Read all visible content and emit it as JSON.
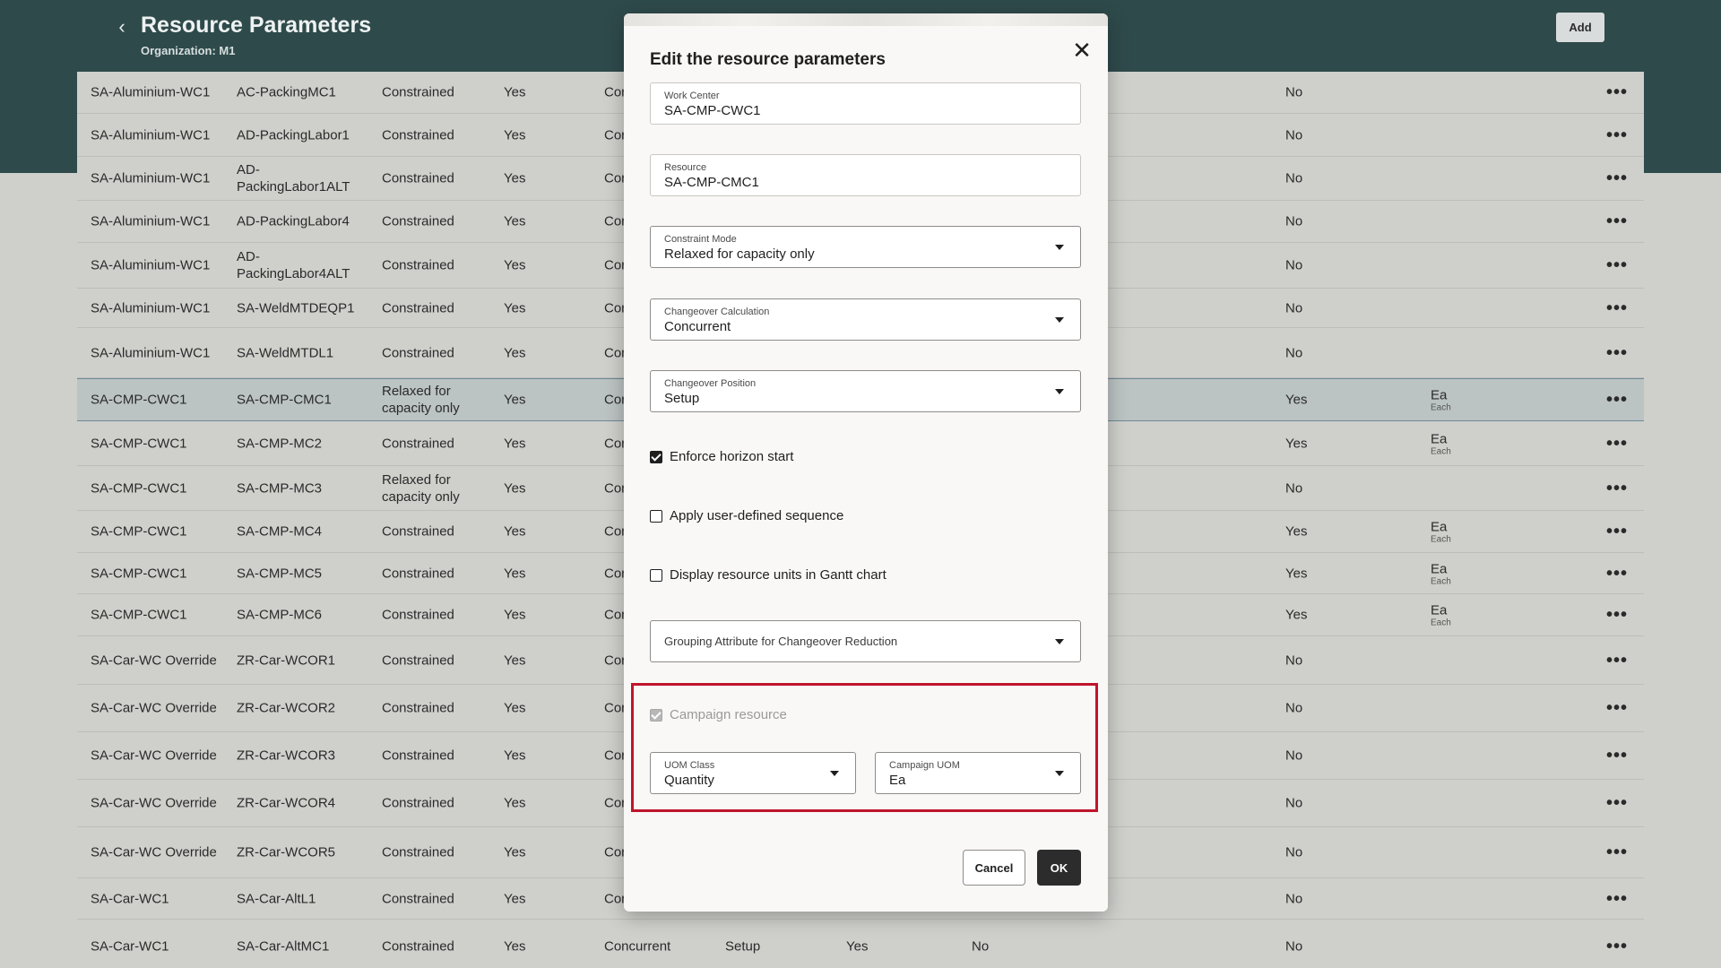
{
  "header": {
    "title": "Resource Parameters",
    "subtitle": "Organization: M1",
    "add_label": "Add",
    "back_icon": "chevron-left-icon"
  },
  "table": {
    "rows": [
      {
        "wc": "SA-Aluminium-WC1",
        "res": "AC-PackingMC1",
        "mode": "Constrained",
        "c4": "Yes",
        "c5": "Con",
        "c9": "No",
        "uom": "",
        "uom_sub": ""
      },
      {
        "wc": "SA-Aluminium-WC1",
        "res": "AD-PackingLabor1",
        "mode": "Constrained",
        "c4": "Yes",
        "c5": "Con",
        "c9": "No",
        "uom": "",
        "uom_sub": ""
      },
      {
        "wc": "SA-Aluminium-WC1",
        "res": "AD-PackingLabor1ALT",
        "mode": "Constrained",
        "c4": "Yes",
        "c5": "Con",
        "c9": "No",
        "uom": "",
        "uom_sub": ""
      },
      {
        "wc": "SA-Aluminium-WC1",
        "res": "AD-PackingLabor4",
        "mode": "Constrained",
        "c4": "Yes",
        "c5": "Con",
        "c9": "No",
        "uom": "",
        "uom_sub": ""
      },
      {
        "wc": "SA-Aluminium-WC1",
        "res": "AD-PackingLabor4ALT",
        "mode": "Constrained",
        "c4": "Yes",
        "c5": "Con",
        "c9": "No",
        "uom": "",
        "uom_sub": ""
      },
      {
        "wc": "SA-Aluminium-WC1",
        "res": "SA-WeldMTDEQP1",
        "mode": "Constrained",
        "c4": "Yes",
        "c5": "Con",
        "c9": "No",
        "uom": "",
        "uom_sub": ""
      },
      {
        "wc": "SA-Aluminium-WC1",
        "res": "SA-WeldMTDL1",
        "mode": "Constrained",
        "c4": "Yes",
        "c5": "Con",
        "c9": "No",
        "uom": "",
        "uom_sub": ""
      },
      {
        "wc": "SA-CMP-CWC1",
        "res": "SA-CMP-CMC1",
        "mode": "Relaxed for capacity only",
        "c4": "Yes",
        "c5": "Con",
        "c9": "Yes",
        "uom": "Ea",
        "uom_sub": "Each"
      },
      {
        "wc": "SA-CMP-CWC1",
        "res": "SA-CMP-MC2",
        "mode": "Constrained",
        "c4": "Yes",
        "c5": "Con",
        "c9": "Yes",
        "uom": "Ea",
        "uom_sub": "Each"
      },
      {
        "wc": "SA-CMP-CWC1",
        "res": "SA-CMP-MC3",
        "mode": "Relaxed for capacity only",
        "c4": "Yes",
        "c5": "Con",
        "c9": "No",
        "uom": "",
        "uom_sub": ""
      },
      {
        "wc": "SA-CMP-CWC1",
        "res": "SA-CMP-MC4",
        "mode": "Constrained",
        "c4": "Yes",
        "c5": "Con",
        "c9": "Yes",
        "uom": "Ea",
        "uom_sub": "Each"
      },
      {
        "wc": "SA-CMP-CWC1",
        "res": "SA-CMP-MC5",
        "mode": "Constrained",
        "c4": "Yes",
        "c5": "Con",
        "c9": "Yes",
        "uom": "Ea",
        "uom_sub": "Each"
      },
      {
        "wc": "SA-CMP-CWC1",
        "res": "SA-CMP-MC6",
        "mode": "Constrained",
        "c4": "Yes",
        "c5": "Con",
        "c9": "Yes",
        "uom": "Ea",
        "uom_sub": "Each"
      },
      {
        "wc": "SA-Car-WC Override",
        "res": "ZR-Car-WCOR1",
        "mode": "Constrained",
        "c4": "Yes",
        "c5": "Con",
        "c9": "No",
        "uom": "",
        "uom_sub": ""
      },
      {
        "wc": "SA-Car-WC Override",
        "res": "ZR-Car-WCOR2",
        "mode": "Constrained",
        "c4": "Yes",
        "c5": "Con",
        "c9": "No",
        "uom": "",
        "uom_sub": ""
      },
      {
        "wc": "SA-Car-WC Override",
        "res": "ZR-Car-WCOR3",
        "mode": "Constrained",
        "c4": "Yes",
        "c5": "Con",
        "c9": "No",
        "uom": "",
        "uom_sub": ""
      },
      {
        "wc": "SA-Car-WC Override",
        "res": "ZR-Car-WCOR4",
        "mode": "Constrained",
        "c4": "Yes",
        "c5": "Con",
        "c9": "No",
        "uom": "",
        "uom_sub": ""
      },
      {
        "wc": "SA-Car-WC Override",
        "res": "ZR-Car-WCOR5",
        "mode": "Constrained",
        "c4": "Yes",
        "c5": "Con",
        "c9": "No",
        "uom": "",
        "uom_sub": ""
      },
      {
        "wc": "SA-Car-WC1",
        "res": "SA-Car-AltL1",
        "mode": "Constrained",
        "c4": "Yes",
        "c5": "Con",
        "c9": "No",
        "uom": "",
        "uom_sub": ""
      },
      {
        "wc": "SA-Car-WC1",
        "res": "SA-Car-AltMC1",
        "mode": "Constrained",
        "c4": "Yes",
        "c5": "Concurrent",
        "c6": "Setup",
        "c7": "Yes",
        "c8": "No",
        "c9": "No",
        "uom": "",
        "uom_sub": ""
      }
    ],
    "more_label": "•••"
  },
  "dialog": {
    "title": "Edit the resource parameters",
    "close_icon": "close-icon",
    "work_center": {
      "label": "Work Center",
      "value": "SA-CMP-CWC1"
    },
    "resource": {
      "label": "Resource",
      "value": "SA-CMP-CMC1"
    },
    "constraint_mode": {
      "label": "Constraint Mode",
      "value": "Relaxed for capacity only"
    },
    "changeover_calc": {
      "label": "Changeover Calculation",
      "value": "Concurrent"
    },
    "changeover_pos": {
      "label": "Changeover Position",
      "value": "Setup"
    },
    "enforce_horizon": {
      "label": "Enforce horizon start",
      "checked": true
    },
    "apply_sequence": {
      "label": "Apply user-defined sequence",
      "checked": false
    },
    "display_units": {
      "label": "Display resource units in Gantt chart",
      "checked": false
    },
    "grouping_attr": {
      "placeholder": "Grouping Attribute for Changeover Reduction"
    },
    "campaign_resource": {
      "label": "Campaign resource",
      "checked": true,
      "disabled": true
    },
    "uom_class": {
      "label": "UOM Class",
      "value": "Quantity"
    },
    "campaign_uom": {
      "label": "Campaign UOM",
      "value": "Ea"
    },
    "cancel_label": "Cancel",
    "ok_label": "OK"
  },
  "colors": {
    "header_bg": "#2f4a4b",
    "highlight": "#c0142c",
    "ok_bg": "#2c2c2c"
  }
}
